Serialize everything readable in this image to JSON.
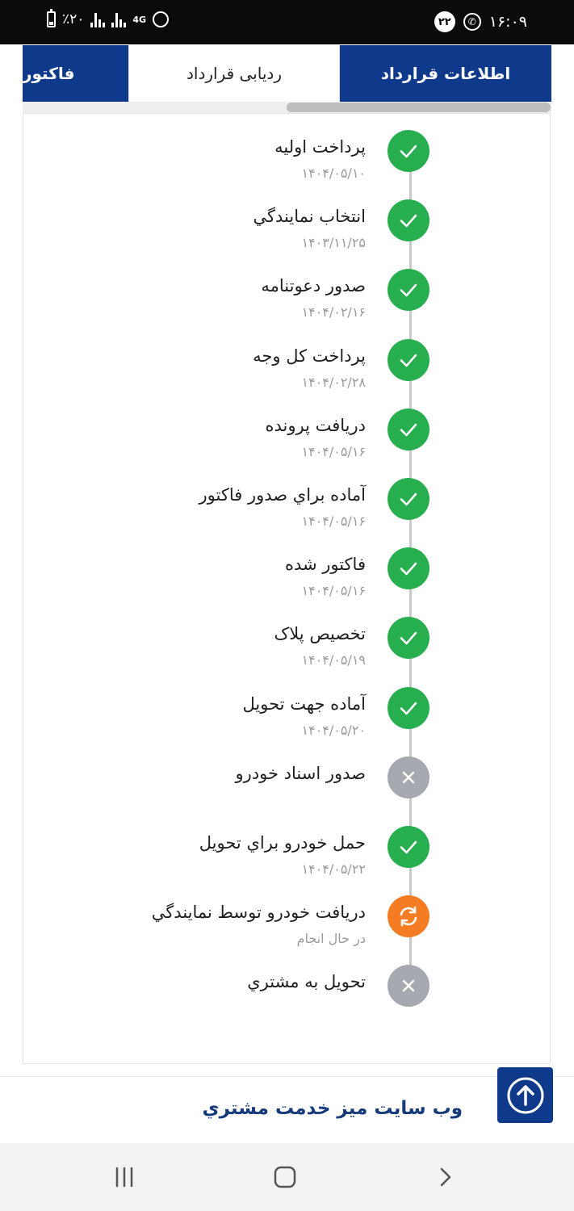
{
  "status_bar": {
    "time": "۱۶:۰۹",
    "notification_count": "۲۲",
    "battery": "٪۲۰",
    "network": "4G"
  },
  "tabs": [
    {
      "label": "اطلاعات قرارداد",
      "active": false
    },
    {
      "label": "ردیابی قرارداد",
      "active": true
    },
    {
      "label": "فاکتور",
      "active": false
    }
  ],
  "timeline": [
    {
      "title": "پرداخت اوليه",
      "date": "۱۴۰۴/۰۵/۱۰",
      "status": "done"
    },
    {
      "title": "انتخاب نمايندگي",
      "date": "۱۴۰۳/۱۱/۲۵",
      "status": "done"
    },
    {
      "title": "صدور دعوتنامه",
      "date": "۱۴۰۴/۰۲/۱۶",
      "status": "done"
    },
    {
      "title": "پرداخت کل وجه",
      "date": "۱۴۰۴/۰۲/۲۸",
      "status": "done"
    },
    {
      "title": "دريافت پرونده",
      "date": "۱۴۰۴/۰۵/۱۶",
      "status": "done"
    },
    {
      "title": "آماده براي صدور فاکتور",
      "date": "۱۴۰۴/۰۵/۱۶",
      "status": "done"
    },
    {
      "title": "فاکتور شده",
      "date": "۱۴۰۴/۰۵/۱۶",
      "status": "done"
    },
    {
      "title": "تخصيص پلاک",
      "date": "۱۴۰۴/۰۵/۱۹",
      "status": "done"
    },
    {
      "title": "آماده جهت تحويل",
      "date": "۱۴۰۴/۰۵/۲۰",
      "status": "done"
    },
    {
      "title": "صدور اسناد خودرو",
      "date": "",
      "status": "cancel"
    },
    {
      "title": "حمل خودرو براي تحويل",
      "date": "۱۴۰۴/۰۵/۲۲",
      "status": "done"
    },
    {
      "title": "دريافت خودرو توسط نمايندگي",
      "date": "در حال انجام",
      "status": "progress"
    },
    {
      "title": "تحويل به مشتري",
      "date": "",
      "status": "cancel"
    }
  ],
  "footer": {
    "link_label": "وب سايت ميز خدمت مشتري"
  },
  "colors": {
    "primary": "#0f3a8c",
    "done": "#27ae4f",
    "cancel": "#a7a9b0",
    "progress": "#f57c22"
  }
}
